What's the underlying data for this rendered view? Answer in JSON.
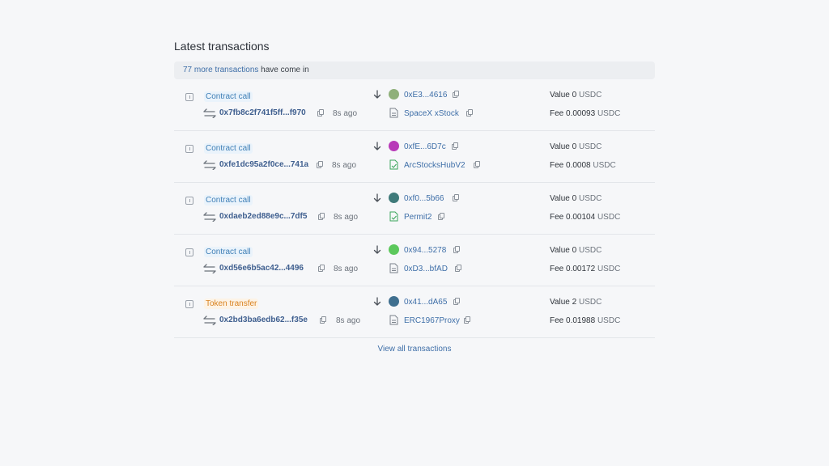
{
  "section": {
    "title": "Latest transactions",
    "banner_link": "77 more transactions",
    "banner_rest": " have come in",
    "view_all": "View all transactions"
  },
  "transactions": [
    {
      "type": "Contract call",
      "type_kind": "contract",
      "hash": "0x7fb8c2f741f5ff...f970",
      "age": "8s ago",
      "from": "0xE3...4616",
      "from_avatar_color": "#8fb07a",
      "to": "SpaceX xStock",
      "to_icon": "document-icon",
      "value_label": "Value",
      "value": "0",
      "fee_label": "Fee",
      "fee": "0.00093",
      "unit": "USDC"
    },
    {
      "type": "Contract call",
      "type_kind": "contract",
      "hash": "0xfe1dc95a2f0ce...741a",
      "age": "8s ago",
      "from": "0xfE...6D7c",
      "from_avatar_color": "#b83ab8",
      "to": "ArcStocksHubV2",
      "to_icon": "verified-document-icon",
      "value_label": "Value",
      "value": "0",
      "fee_label": "Fee",
      "fee": "0.0008",
      "unit": "USDC"
    },
    {
      "type": "Contract call",
      "type_kind": "contract",
      "hash": "0xdaeb2ed88e9c...7df5",
      "age": "8s ago",
      "from": "0xf0...5b66",
      "from_avatar_color": "#3f7a7a",
      "to": "Permit2",
      "to_icon": "verified-document-icon",
      "value_label": "Value",
      "value": "0",
      "fee_label": "Fee",
      "fee": "0.00104",
      "unit": "USDC"
    },
    {
      "type": "Contract call",
      "type_kind": "contract",
      "hash": "0xd56e6b5ac42...4496",
      "age": "8s ago",
      "from": "0x94...5278",
      "from_avatar_color": "#5cc85c",
      "to": "0xD3...bfAD",
      "to_icon": "document-icon",
      "value_label": "Value",
      "value": "0",
      "fee_label": "Fee",
      "fee": "0.00172",
      "unit": "USDC"
    },
    {
      "type": "Token transfer",
      "type_kind": "token",
      "hash": "0x2bd3ba6edb62...f35e",
      "age": "8s ago",
      "from": "0x41...dA65",
      "from_avatar_color": "#3f6f8f",
      "to": "ERC1967Proxy",
      "to_icon": "document-icon",
      "value_label": "Value",
      "value": "2",
      "fee_label": "Fee",
      "fee": "0.01988",
      "unit": "USDC"
    }
  ],
  "colors": {
    "link": "#3f6fa8",
    "contract_badge": "#3f7fb6",
    "token_badge": "#d9821f",
    "verified_green": "#3aa55a"
  }
}
